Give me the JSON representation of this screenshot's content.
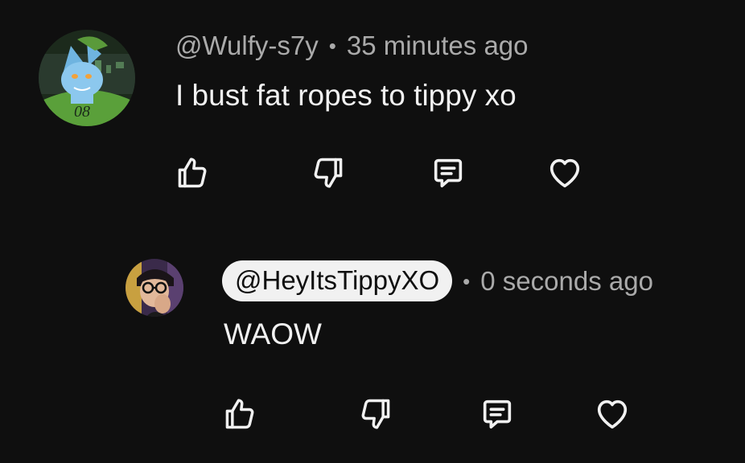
{
  "comments": [
    {
      "author": "@Wulfy-s7y",
      "separator": "•",
      "time": "35 minutes ago",
      "text": "I bust fat ropes to tippy xo",
      "avatar_badge": "08",
      "avatar_icon": "wolf-avatar"
    },
    {
      "author": "@HeyItsTippyXO",
      "separator": "•",
      "time": "0 seconds ago",
      "text": "WAOW",
      "author_highlighted": true,
      "avatar_icon": "user-photo-avatar"
    }
  ],
  "actions": [
    "thumbs-up-icon",
    "thumbs-down-icon",
    "reply-icon",
    "heart-icon"
  ],
  "colors": {
    "background": "#0f0f0f",
    "text": "#f1f1f1",
    "meta": "#aaaaaa",
    "chip_bg": "#f1f1f1",
    "chip_text": "#0f0f0f"
  }
}
